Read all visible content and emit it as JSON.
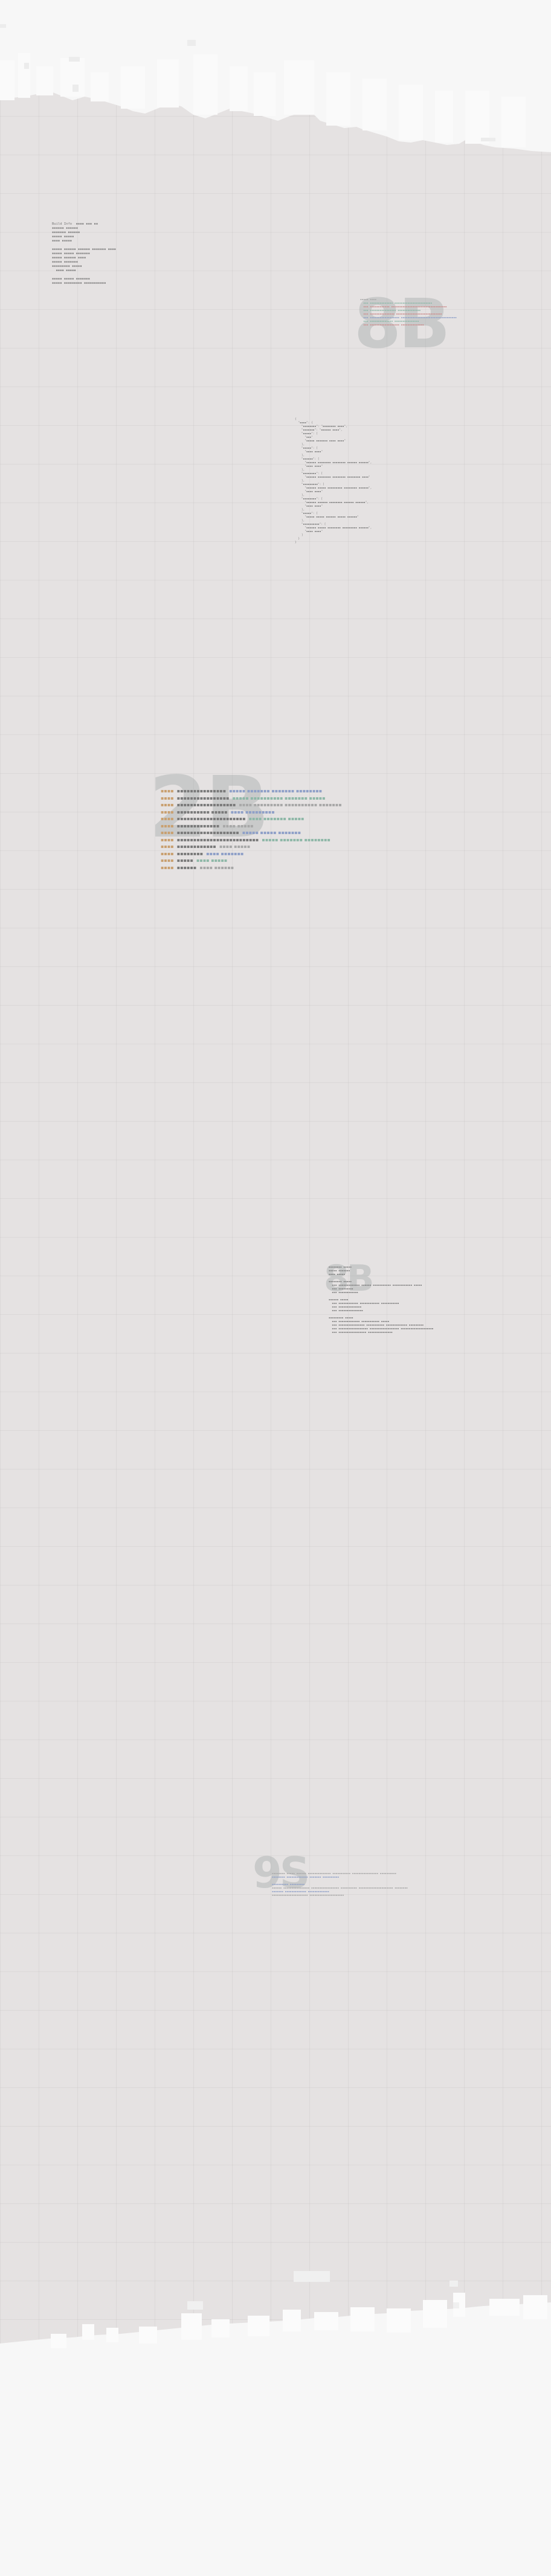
{
  "colors": {
    "background": "#e5e2e2",
    "skyline": "#f7f7f7",
    "ghost_text": "#9aa3a3",
    "accent_green": "#8fb8a8",
    "accent_red": "#cc8d8d",
    "accent_orange": "#c9a070",
    "accent_blue": "#8fa0c8"
  },
  "header_block": {
    "lines": [
      "Build Info  ▪▪▪▪ ▪▪▪ ▪▪",
      "▪▪▪▪▪▪ ▪▪▪▪▪▪",
      "▪▪▪▪▪▪▪ ▪▪▪▪▪▪",
      "▪▪▪▪▪ ▪▪▪▪▪",
      "▪▪▪▪ ▪▪▪▪▪",
      "",
      "▪▪▪▪▪ ▪▪▪▪▪▪ ▪▪▪▪▪▪ ▪▪▪▪▪▪▪ ▪▪▪▪",
      "▪▪▪▪▪ ▪▪▪▪▪ ▪▪▪▪▪▪▪",
      "▪▪▪▪▪ ▪▪▪▪▪▪ ▪▪▪▪",
      "▪▪▪▪▪ ▪▪▪▪▪▪▪",
      "▪▪▪▪▪▪▪▪▪ ▪▪▪▪▪",
      "  ▪▪▪▪ ▪▪▪▪▪",
      "",
      "▪▪▪▪▪ ▪▪▪▪▪ ▪▪▪▪▪▪▪",
      "▪▪▪▪▪ ▪▪▪▪▪▪▪▪▪ ▪▪▪▪▪▪▪▪▪▪▪"
    ]
  },
  "section_8b_top": {
    "ghost": "8B",
    "lines": [
      "▪▪▪▪▪ ▪▪▪▪",
      "  ▪▪▪ ▪▪▪▪▪▪▪▪▪▪▪▪▪▪ ▪▪▪▪▪▪▪▪▪▪▪▪▪▪▪▪▪▪▪▪▪▪▪",
      "  ▪▪▪ ▪▪▪▪▪▪▪▪▪▪▪▪ ▪▪▪▪▪▪▪▪▪▪▪▪▪▪▪▪▪▪▪▪▪▪▪▪▪▪▪▪▪▪▪▪▪▪",
      "  ▪▪▪ ▪▪▪▪▪▪▪▪▪▪▪▪▪▪▪▪ ▪▪▪▪▪▪▪▪▪▪▪▪▪▪",
      "  ▪▪▪ ▪▪▪▪▪▪▪▪▪▪▪▪▪▪▪ ▪▪▪▪▪▪▪▪▪▪▪▪▪▪▪▪▪▪▪▪▪▪▪▪▪▪▪▪",
      "  ▪▪▪ ▪▪▪▪▪▪▪▪▪▪▪▪▪▪▪▪▪▪ ▪▪▪▪▪▪▪▪▪▪▪▪▪▪▪▪▪▪▪▪▪▪▪▪▪▪▪▪▪▪▪▪▪▪",
      "  ▪▪▪ ▪▪▪▪▪▪▪▪▪▪▪▪▪▪ ▪▪▪▪▪▪▪▪▪▪▪▪▪▪▪",
      "  ▪▪▪ ▪▪▪▪▪▪▪▪▪▪▪▪▪▪▪▪▪▪ ▪▪▪▪▪▪▪▪▪▪▪▪▪▪"
    ]
  },
  "json_block": {
    "lines": [
      "{",
      "  \"▪▪▪▪\": {",
      "    \"▪▪▪▪▪▪▪▪\": \"▪▪▪▪▪▪▪▪ ▪▪▪▪\",",
      "    \"▪▪▪▪▪▪▪\": \"▪▪▪▪▪▪ ▪▪▪▪\",",
      "    \"▪▪▪▪▪\": [",
      "      \"▪▪▪\"",
      "      \"▪▪▪▪▪ ▪▪▪▪▪▪▪ ▪▪▪▪ ▪▪▪▪\"",
      "    ],",
      "    \"▪▪▪▪▪\": [",
      "      \"▪▪▪▪ ▪▪▪▪\"",
      "    ],",
      "    \"▪▪▪▪▪▪\": [",
      "      \"▪▪▪▪▪▪ ▪▪▪▪▪▪▪▪ ▪▪▪▪▪▪▪▪ ▪▪▪▪▪▪ ▪▪▪▪▪▪\",",
      "      \"▪▪▪▪ ▪▪▪▪\"",
      "    ],",
      "    \"▪▪▪▪▪▪▪▪\": [",
      "      \"▪▪▪▪▪▪ ▪▪▪▪▪▪▪▪ ▪▪▪▪▪▪▪▪ ▪▪▪▪▪▪▪▪ ▪▪▪▪\"",
      "    ],",
      "    \"▪▪▪▪▪▪▪▪▪\": [",
      "      \"▪▪▪▪▪▪ ▪▪▪▪▪ ▪▪▪▪▪▪▪▪▪ ▪▪▪▪▪▪▪▪ ▪▪▪▪▪▪\",",
      "      \"▪▪▪▪ ▪▪▪▪\"",
      "    ],",
      "    \"▪▪▪▪▪▪▪▪\": [",
      "      \"▪▪▪▪▪▪ ▪▪▪▪▪▪ ▪▪▪▪▪▪▪▪ ▪▪▪▪▪▪ ▪▪▪▪▪▪\",",
      "      \"▪▪▪▪ ▪▪▪▪\"",
      "    ],",
      "    \"▪▪▪▪▪\": [",
      "      \"▪▪▪▪▪ ▪▪▪▪▪ ▪▪▪▪▪▪ ▪▪▪▪▪ ▪▪▪▪▪▪\"",
      "    ],",
      "    \"▪▪▪▪▪▪▪▪▪▪\": [",
      "      \"▪▪▪▪▪▪ ▪▪▪▪▪ ▪▪▪▪▪▪▪▪ ▪▪▪▪▪▪▪▪▪ ▪▪▪▪▪▪\",",
      "      \"▪▪▪▪ ▪▪▪▪\"",
      "    ]",
      "  }",
      "}"
    ]
  },
  "section_2b": {
    "ghost": "2B",
    "rows": [
      {
        "num": "▪▪▪▪",
        "name": "▪▪▪▪▪▪▪▪▪▪▪▪▪▪▪",
        "note": "▪▪▪▪▪ ▪▪▪▪▪▪▪ ▪▪▪▪▪▪▪ ▪▪▪▪▪▪▪▪"
      },
      {
        "num": "▪▪▪▪",
        "name": "▪▪▪▪▪▪▪▪▪▪▪▪▪▪▪▪",
        "note": "▪▪▪▪▪ ▪▪▪▪▪▪▪▪▪▪ ▪▪▪▪▪▪▪ ▪▪▪▪▪"
      },
      {
        "num": "▪▪▪▪",
        "name": "▪▪▪▪▪▪▪▪▪▪▪▪▪▪▪▪▪▪",
        "note": "▪▪▪▪ ▪▪▪▪▪▪▪▪▪ ▪▪▪▪▪▪▪▪▪▪ ▪▪▪▪▪▪▪"
      },
      {
        "num": "▪▪▪▪",
        "name": "▪▪▪▪▪▪▪▪▪▪ ▪▪▪▪▪",
        "note": "▪▪▪▪ ▪▪▪▪▪▪▪▪▪"
      },
      {
        "num": "▪▪▪▪",
        "name": "▪▪▪▪▪▪▪▪▪▪▪▪▪▪▪▪▪▪▪▪▪",
        "note": "▪▪▪▪ ▪▪▪▪▪▪▪ ▪▪▪▪▪"
      },
      {
        "num": "▪▪▪▪",
        "name": "▪▪▪▪▪▪▪▪▪▪▪▪▪",
        "note": "▪▪▪▪ ▪▪▪▪▪"
      },
      {
        "num": "▪▪▪▪",
        "name": "▪▪▪▪▪▪▪▪▪▪▪▪▪▪▪▪▪▪▪",
        "note": "▪▪▪▪▪ ▪▪▪▪▪ ▪▪▪▪▪▪▪"
      },
      {
        "num": "▪▪▪▪",
        "name": "▪▪▪▪▪▪▪▪▪▪▪▪▪▪▪▪▪▪▪▪▪▪▪▪▪",
        "note": "▪▪▪▪▪ ▪▪▪▪▪▪▪ ▪▪▪▪▪▪▪▪"
      },
      {
        "num": "▪▪▪▪",
        "name": "▪▪▪▪▪▪▪▪▪▪▪▪",
        "note": "▪▪▪▪ ▪▪▪▪▪"
      },
      {
        "num": "▪▪▪▪",
        "name": "▪▪▪▪▪▪▪▪",
        "note": "▪▪▪▪ ▪▪▪▪▪▪▪"
      },
      {
        "num": "▪▪▪▪",
        "name": "▪▪▪▪▪",
        "note": "▪▪▪▪ ▪▪▪▪▪"
      },
      {
        "num": "▪▪▪▪",
        "name": "▪▪▪▪▪▪",
        "note": "▪▪▪▪ ▪▪▪▪▪▪"
      }
    ]
  },
  "section_8b_mid": {
    "ghost": "8B",
    "lines": [
      "▪▪▪▪▪▪▪▪ ▪▪▪▪▪",
      "▪▪▪▪▪ ▪▪▪▪▪▪▪",
      "▪▪▪▪ ▪▪▪▪▪",
      "",
      "▪▪▪▪▪▪▪▪ ▪▪▪▪▪",
      "  ▪▪▪ ▪▪▪▪▪▪▪▪▪▪▪▪▪ ▪▪▪▪▪▪ ▪▪▪▪▪▪▪▪▪▪▪ ▪▪▪▪▪▪▪▪▪▪▪▪ ▪▪▪▪▪",
      "  ▪▪▪ ▪▪▪▪▪▪▪▪▪",
      "  ▪▪▪ ▪▪▪▪▪▪▪▪▪▪▪▪",
      "",
      "▪▪▪▪▪▪ ▪▪▪▪▪",
      "  ▪▪▪ ▪▪▪▪▪▪▪▪▪▪▪▪ ▪▪▪▪▪▪▪▪▪▪▪▪ ▪▪▪▪▪▪▪▪▪▪▪",
      "  ▪▪▪ ▪▪▪▪▪▪▪▪▪▪▪▪▪▪",
      "  ▪▪▪ ▪▪▪▪▪▪▪▪▪▪▪▪▪▪▪",
      "",
      "▪▪▪▪▪▪▪▪▪ ▪▪▪▪▪",
      "  ▪▪▪ ▪▪▪▪▪▪▪▪▪▪▪▪▪ ▪▪▪▪▪▪▪▪▪▪▪ ▪▪▪▪▪",
      "  ▪▪▪ ▪▪▪▪▪▪▪▪▪▪▪▪▪▪▪▪ ▪▪▪▪▪▪▪▪▪▪▪ ▪▪▪▪▪▪▪▪▪▪▪▪▪ ▪▪▪▪▪▪▪▪▪",
      "  ▪▪▪ ▪▪▪▪▪▪▪▪▪▪▪▪▪▪▪▪▪▪ ▪▪▪▪▪▪▪▪▪▪▪▪▪▪▪▪▪▪ ▪▪▪▪▪▪▪▪▪▪▪▪▪▪▪▪▪▪▪▪",
      "  ▪▪▪ ▪▪▪▪▪▪▪▪▪▪▪▪▪▪▪▪▪ ▪▪▪▪▪▪▪▪▪▪▪▪▪▪▪"
    ]
  },
  "section_9s": {
    "ghost": "9S",
    "lines": [
      "▪▪▪▪▪▪▪▪ ▪▪▪▪▪ ▪▪▪▪▪▪ ▪▪▪▪▪▪▪▪▪▪▪▪▪▪ ▪▪▪▪▪▪▪▪▪▪▪ ▪▪▪▪▪▪▪▪▪▪▪▪▪▪▪▪ ▪▪▪▪▪▪▪▪▪▪",
      "▪▪▪▪▪▪▪▪ ▪▪▪▪▪▪▪▪▪▪▪▪▪ ▪▪▪▪▪▪▪ ▪▪▪▪▪▪▪▪▪▪",
      "",
      "▪▪▪▪▪▪▪▪▪▪ ▪▪▪▪▪▪▪▪▪",
      "▪▪▪▪▪▪ ▪▪▪▪▪▪▪▪▪▪▪▪▪▪▪▪ ▪▪▪▪▪▪▪▪▪▪▪▪▪▪▪▪▪ ▪▪▪▪▪▪▪▪▪▪ ▪▪▪▪▪▪▪▪▪▪▪▪▪▪▪▪▪▪▪▪▪ ▪▪▪▪▪▪▪▪",
      "▪▪▪▪▪▪▪ ▪▪▪▪▪▪▪▪▪▪▪▪▪ ▪▪▪▪▪▪▪▪▪▪▪▪▪",
      "▪▪▪▪▪▪▪▪▪▪▪▪▪▪▪▪▪▪▪▪▪▪ ▪▪▪▪▪▪▪▪▪▪▪▪▪▪▪▪▪▪▪▪▪"
    ]
  }
}
